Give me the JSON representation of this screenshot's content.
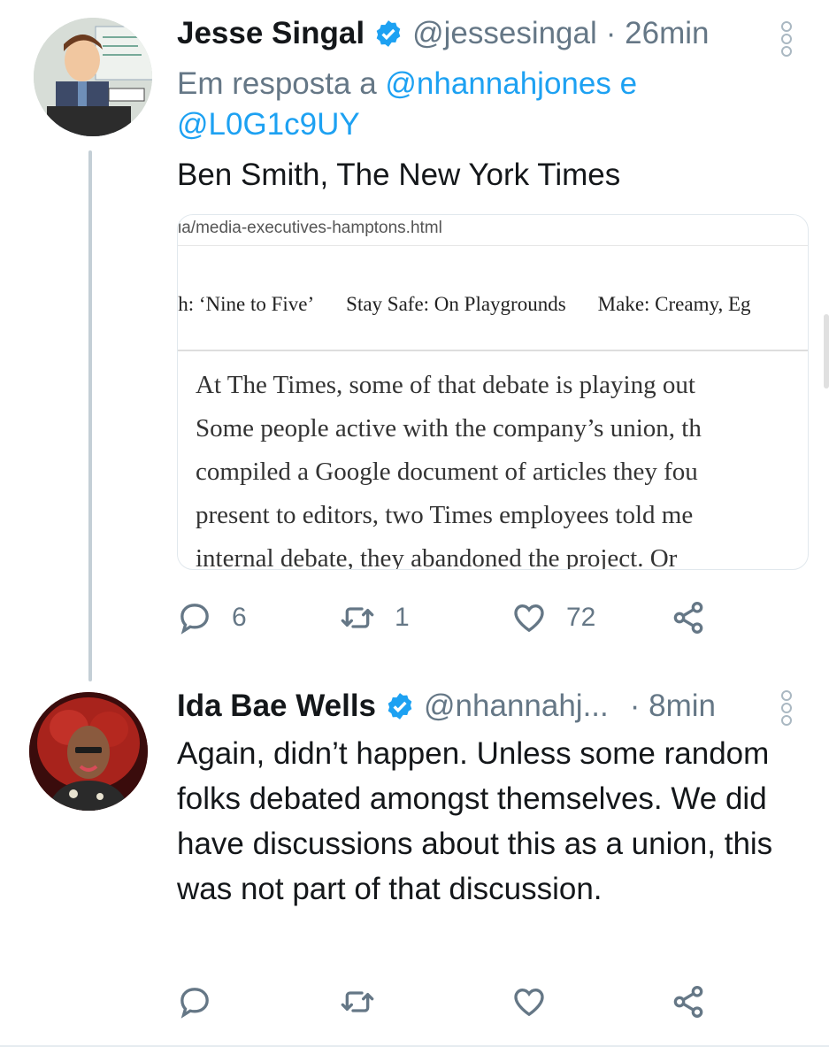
{
  "tweet1": {
    "display_name": "Jesse Singal",
    "handle": "@jessesingal",
    "time": "· 26min",
    "reply_prefix": "Em resposta a",
    "reply_mention1": "@nhannahjones",
    "reply_joiner": "e",
    "reply_mention2": "@L0G1c9UY",
    "text": "Ben Smith, The New York Times",
    "card": {
      "url": "ia/media-executives-hamptons.html",
      "nav": [
        "ch: ‘Nine to Five’",
        "Stay Safe: On Playgrounds",
        "Make: Creamy, Eg"
      ],
      "lines": [
        "At The Times, some of that debate is playing out",
        "Some people active with the company’s union, th",
        "compiled a Google document of articles they fou",
        "present to editors, two Times employees told me",
        "internal debate, they abandoned the project. Or"
      ]
    },
    "replies": "6",
    "retweets": "1",
    "likes": "72"
  },
  "tweet2": {
    "display_name": "Ida Bae Wells",
    "handle": "@nhannahj...",
    "time": "· 8min",
    "text": "Again, didn’t happen. Unless some random folks debated amongst themselves. We did have discussions about this as a union, this was not part of that discussion."
  },
  "icons": {
    "verified": "verified-badge-icon",
    "reply": "reply-icon",
    "retweet": "retweet-icon",
    "like": "heart-icon",
    "share": "share-icon",
    "more": "more-vertical-icon"
  },
  "colors": {
    "verified": "#1da1f2",
    "link": "#1da1f2",
    "muted": "#657786"
  }
}
